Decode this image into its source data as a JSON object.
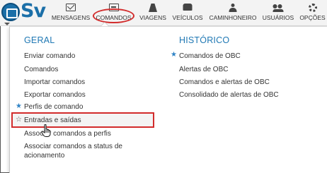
{
  "logo": {
    "text": "Sv"
  },
  "nav": {
    "items": [
      {
        "id": "mensagens",
        "label": "MENSAGENS",
        "icon": "envelope-icon"
      },
      {
        "id": "comandos",
        "label": "COMANDOS",
        "icon": "command-list-icon"
      },
      {
        "id": "viagens",
        "label": "VIAGENS",
        "icon": "road-icon"
      },
      {
        "id": "veiculos",
        "label": "VEÍCULOS",
        "icon": "car-icon"
      },
      {
        "id": "caminhoneiro",
        "label": "CAMINHONEIRO",
        "icon": "driver-icon"
      },
      {
        "id": "usuarios",
        "label": "USUÁRIOS",
        "icon": "users-icon"
      },
      {
        "id": "opcoes",
        "label": "OPÇÕES",
        "icon": "gear-icon"
      }
    ]
  },
  "menu": {
    "geral": {
      "title": "GERAL",
      "items": [
        {
          "label": "Enviar comando",
          "star": "none"
        },
        {
          "label": "Comandos",
          "star": "none"
        },
        {
          "label": "Importar comandos",
          "star": "none"
        },
        {
          "label": "Exportar comandos",
          "star": "none"
        },
        {
          "label": "Perfis de comando",
          "star": "filled"
        },
        {
          "label": "Entradas e saídas",
          "star": "empty"
        },
        {
          "label": "Associar comandos a perfis",
          "star": "none"
        },
        {
          "label": "Associar comandos a status de acionamento",
          "star": "none"
        }
      ]
    },
    "historico": {
      "title": "HISTÓRICO",
      "items": [
        {
          "label": "Comandos de OBC",
          "star": "filled"
        },
        {
          "label": "Alertas de OBC",
          "star": "none"
        },
        {
          "label": "Comandos e alertas de OBC",
          "star": "none"
        },
        {
          "label": "Consolidado de alertas de OBC",
          "star": "none"
        }
      ]
    }
  },
  "colors": {
    "accent": "#1f78b4",
    "highlight": "#d22c2c",
    "star": "#2f83c6"
  }
}
